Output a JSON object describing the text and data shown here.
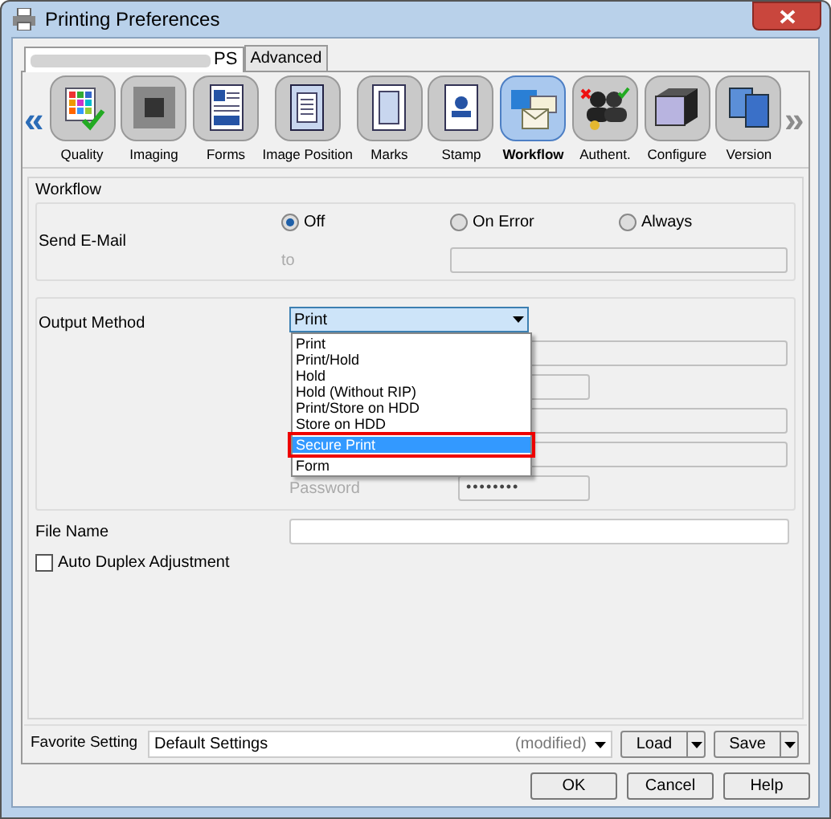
{
  "window": {
    "title": "Printing Preferences"
  },
  "tabs": [
    {
      "label": "PS",
      "selected": true
    },
    {
      "label": "Advanced",
      "selected": false
    }
  ],
  "nav": [
    {
      "symbol": "«",
      "disabled": false
    },
    {
      "symbol": "»",
      "disabled": true
    }
  ],
  "categories": [
    {
      "label": "Quality",
      "selected": false
    },
    {
      "label": "Imaging",
      "selected": false
    },
    {
      "label": "Forms",
      "selected": false
    },
    {
      "label": "Image Position",
      "selected": false
    },
    {
      "label": "Marks",
      "selected": false
    },
    {
      "label": "Stamp",
      "selected": false
    },
    {
      "label": "Workflow",
      "selected": true
    },
    {
      "label": "Authent.",
      "selected": false
    },
    {
      "label": "Configure",
      "selected": false
    },
    {
      "label": "Version",
      "selected": false
    }
  ],
  "section_title": "Workflow",
  "send_email": {
    "label": "Send E-Mail",
    "options": [
      {
        "label": "Off",
        "selected": true
      },
      {
        "label": "On Error",
        "selected": false
      },
      {
        "label": "Always",
        "selected": false
      }
    ],
    "to_label": "to"
  },
  "output_method": {
    "label": "Output Method",
    "value": "Print",
    "expanded": true,
    "options": [
      {
        "label": "Print",
        "highlighted": false
      },
      {
        "label": "Print/Hold",
        "highlighted": false
      },
      {
        "label": "Hold",
        "highlighted": false
      },
      {
        "label": "Hold (Without RIP)",
        "highlighted": false
      },
      {
        "label": "Print/Store on HDD",
        "highlighted": false
      },
      {
        "label": "Store on HDD",
        "highlighted": false
      },
      {
        "label": "Secure Print",
        "highlighted": true
      },
      {
        "label": "Form",
        "highlighted": false
      }
    ],
    "password_label": "Password",
    "password_value": "••••••••"
  },
  "file_name": {
    "label": "File Name"
  },
  "auto_duplex": {
    "label": "Auto Duplex Adjustment",
    "checked": false
  },
  "favorite": {
    "label": "Favorite Setting",
    "value": "Default Settings",
    "status": "(modified)",
    "buttons": [
      "Load",
      "Save"
    ]
  },
  "buttons": [
    "OK",
    "Cancel",
    "Help"
  ]
}
